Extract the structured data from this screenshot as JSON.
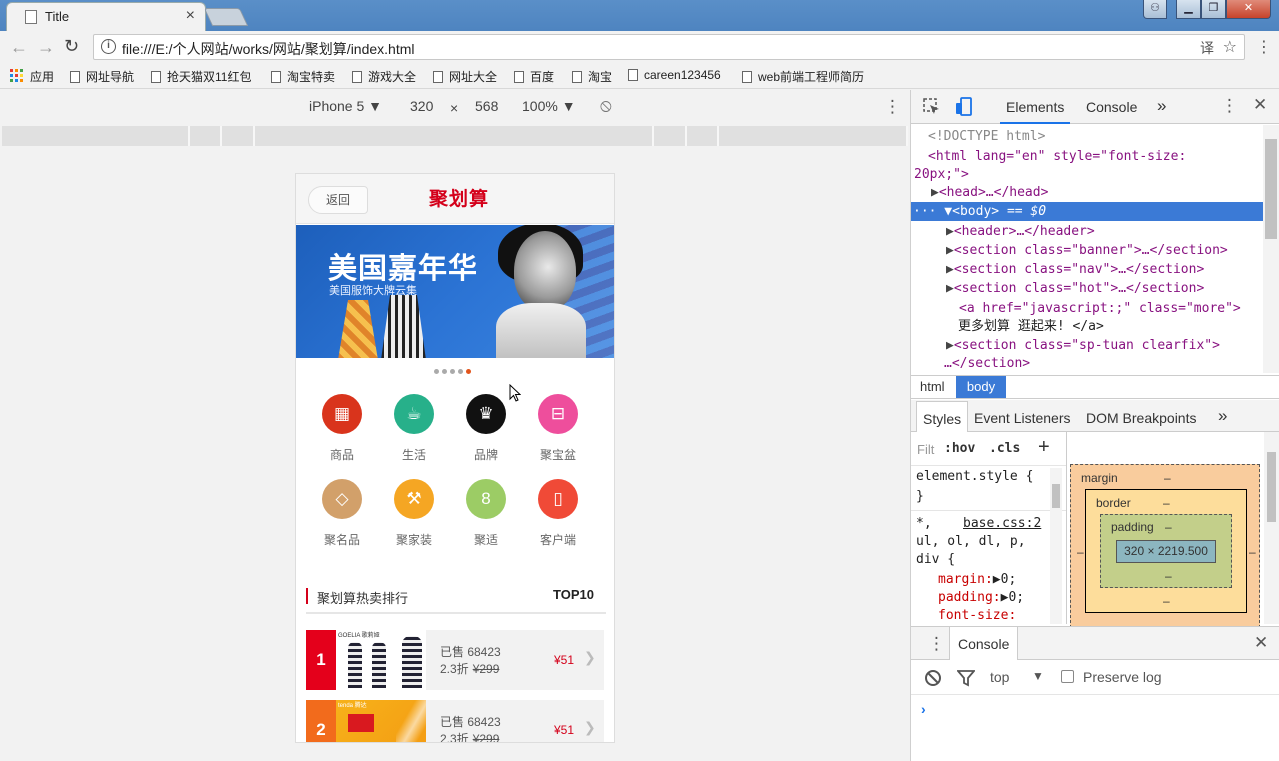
{
  "browser": {
    "tab_title": "Title",
    "tab_close": "×",
    "url": "file:///E:/个人网站/works/网站/聚划算/index.html",
    "back": "←",
    "forward": "→",
    "reload": "↻",
    "star": "☆",
    "translate": "译",
    "menu": "⋮",
    "window_buttons": {
      "user": "⚇",
      "minimize": "▁",
      "maximize": "❐",
      "close": "✕"
    }
  },
  "bookmarks": [
    {
      "label": "应用"
    },
    {
      "label": "网址导航"
    },
    {
      "label": "抢天猫双11红包"
    },
    {
      "label": "淘宝特卖"
    },
    {
      "label": "游戏大全"
    },
    {
      "label": "网址大全"
    },
    {
      "label": "百度"
    },
    {
      "label": "淘宝"
    },
    {
      "label": "careen123456"
    },
    {
      "label": "web前端工程师简历"
    }
  ],
  "device_toolbar": {
    "device": "iPhone 5 ▼",
    "width": "320",
    "times": "×",
    "height": "568",
    "zoom": "100% ▼",
    "rotate": "⦸",
    "more": "⋮"
  },
  "page": {
    "back_label": "返回",
    "title": "聚划算",
    "banner": {
      "title": "美国嘉年华",
      "subtitle": "美国服饰大牌云集"
    },
    "slide_count": 5,
    "active_slide": 5,
    "nav_items": [
      {
        "label": "商品",
        "icon": "▦",
        "color": "#d9341c"
      },
      {
        "label": "生活",
        "icon": "☕",
        "color": "#27b08a"
      },
      {
        "label": "品牌",
        "icon": "♛",
        "color": "#111111"
      },
      {
        "label": "聚宝盆",
        "icon": "⊟",
        "color": "#ee4e9c"
      },
      {
        "label": "聚名品",
        "icon": "◇",
        "color": "#d2a06a"
      },
      {
        "label": "聚家装",
        "icon": "⚒",
        "color": "#f5a623"
      },
      {
        "label": "聚适",
        "icon": "8",
        "color": "#9ccc65"
      },
      {
        "label": "客户端",
        "icon": "▯",
        "color": "#f04a37"
      }
    ],
    "hot": {
      "title": "聚划算热卖排行",
      "top": "TOP10"
    },
    "ranks": [
      {
        "num": "1",
        "sold": "已售 68423",
        "discount": "2.3折",
        "orig": "¥299",
        "price": "¥51",
        "color": "#e4001b",
        "brand": "GOELIA 歌莉娅"
      },
      {
        "num": "2",
        "sold": "已售 68423",
        "discount": "2.3折",
        "orig": "¥299",
        "price": "¥51",
        "color": "#f26b1c",
        "brand": "tenda 腾达"
      }
    ]
  },
  "devtools": {
    "tabs": {
      "elements": "Elements",
      "console": "Console",
      "more": "»"
    },
    "dom": {
      "doctype": "<!DOCTYPE html>",
      "html_open": "<html lang=\"en\" style=\"font-size:",
      "html_open2": "20px;\">",
      "head": "<head>…</head>",
      "body": "<body>",
      "body_eq": "== $0",
      "header": "<header>…</header>",
      "banner": "<section class=\"banner\">…</section>",
      "nav": "<section class=\"nav\">…</section>",
      "hot": "<section class=\"hot\">…</section>",
      "more_a": "<a href=\"javascript:;\" class=\"more\">",
      "more_text": "更多划算 逛起来! </a>",
      "sptuan": "<section class=\"sp-tuan clearfix\">",
      "sptuan_close": "…</section>"
    },
    "breadcrumbs": [
      "html",
      "body"
    ],
    "subtabs": {
      "styles": "Styles",
      "listeners": "Event Listeners",
      "dom_bp": "DOM Breakpoints",
      "more": "»"
    },
    "filter": {
      "placeholder": "Filt",
      "hov": ":hov",
      "cls": ".cls",
      "add": "+"
    },
    "styles_text": {
      "element_style": "element.style {",
      "close": "}",
      "selector1": "*,",
      "source": "base.css:2",
      "selector2": "ul, ol, dl, p,",
      "selector3": "div {",
      "p1": "margin:",
      "p1v": "▶0;",
      "p2": "padding:",
      "p2v": "▶0;",
      "p3": "font-size:"
    },
    "box_model": {
      "margin": "margin",
      "border": "border",
      "padding": "padding",
      "dash": "–",
      "size": "320 × 2219.500"
    },
    "console_drawer": {
      "tab": "Console",
      "context": "top",
      "preserve": "Preserve log",
      "prompt": "›",
      "close": "✕"
    }
  }
}
